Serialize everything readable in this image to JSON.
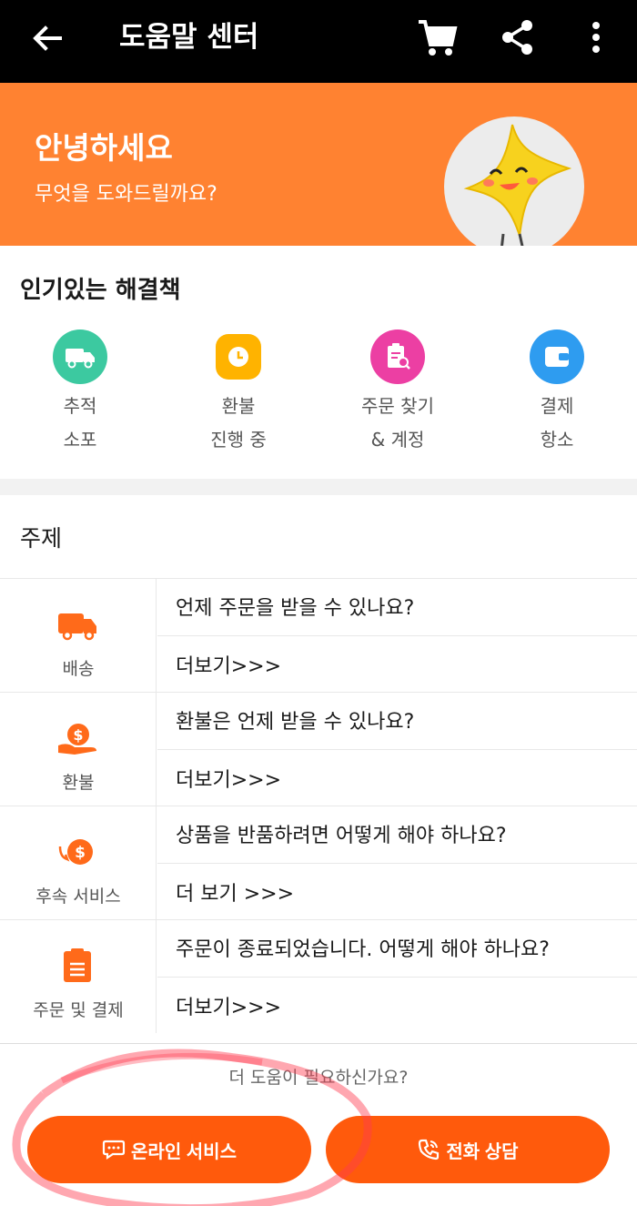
{
  "header": {
    "title": "도움말 센터",
    "icons": [
      "back-arrow-icon",
      "cart-icon",
      "share-icon",
      "more-vertical-icon"
    ]
  },
  "hero": {
    "greeting": "안녕하세요",
    "subtitle": "무엇을 도와드릴까요?",
    "background": "#ff8231"
  },
  "popular": {
    "heading": "인기있는 해결책",
    "items": [
      {
        "line1": "추적",
        "line2": "소포",
        "icon": "truck-icon",
        "color": "#3cc9a0"
      },
      {
        "line1": "환불",
        "line2": "진행 중",
        "icon": "clock-icon",
        "color": "#ffb300"
      },
      {
        "line1": "주문 찾기",
        "line2": "& 계정",
        "icon": "order-search-icon",
        "color": "#ec3fa3"
      },
      {
        "line1": "결제",
        "line2": "항소",
        "icon": "wallet-icon",
        "color": "#2e9cf0"
      }
    ]
  },
  "topics": {
    "heading": "주제",
    "rows": [
      {
        "category": "배송",
        "icon": "delivery-truck-icon",
        "question": "언제 주문을 받을 수 있나요?",
        "more": "더보기>>>"
      },
      {
        "category": "환불",
        "icon": "refund-hand-icon",
        "question": "환불은 언제 받을 수 있나요?",
        "more": "더보기>>>"
      },
      {
        "category": "후속 서비스",
        "icon": "after-service-icon",
        "question": "상품을 반품하려면 어떻게 해야 하나요?",
        "more": "더 보기 >>>"
      },
      {
        "category": "주문 및 결제",
        "icon": "order-clipboard-icon",
        "question": "주문이 종료되었습니다. 어떻게 해야 하나요?",
        "more": "더보기>>>"
      }
    ]
  },
  "bottom": {
    "prompt": "더 도움이 필요하신가요?",
    "online_label": "온라인 서비스",
    "phone_label": "전화 상담",
    "button_color": "#ff5a0c"
  }
}
